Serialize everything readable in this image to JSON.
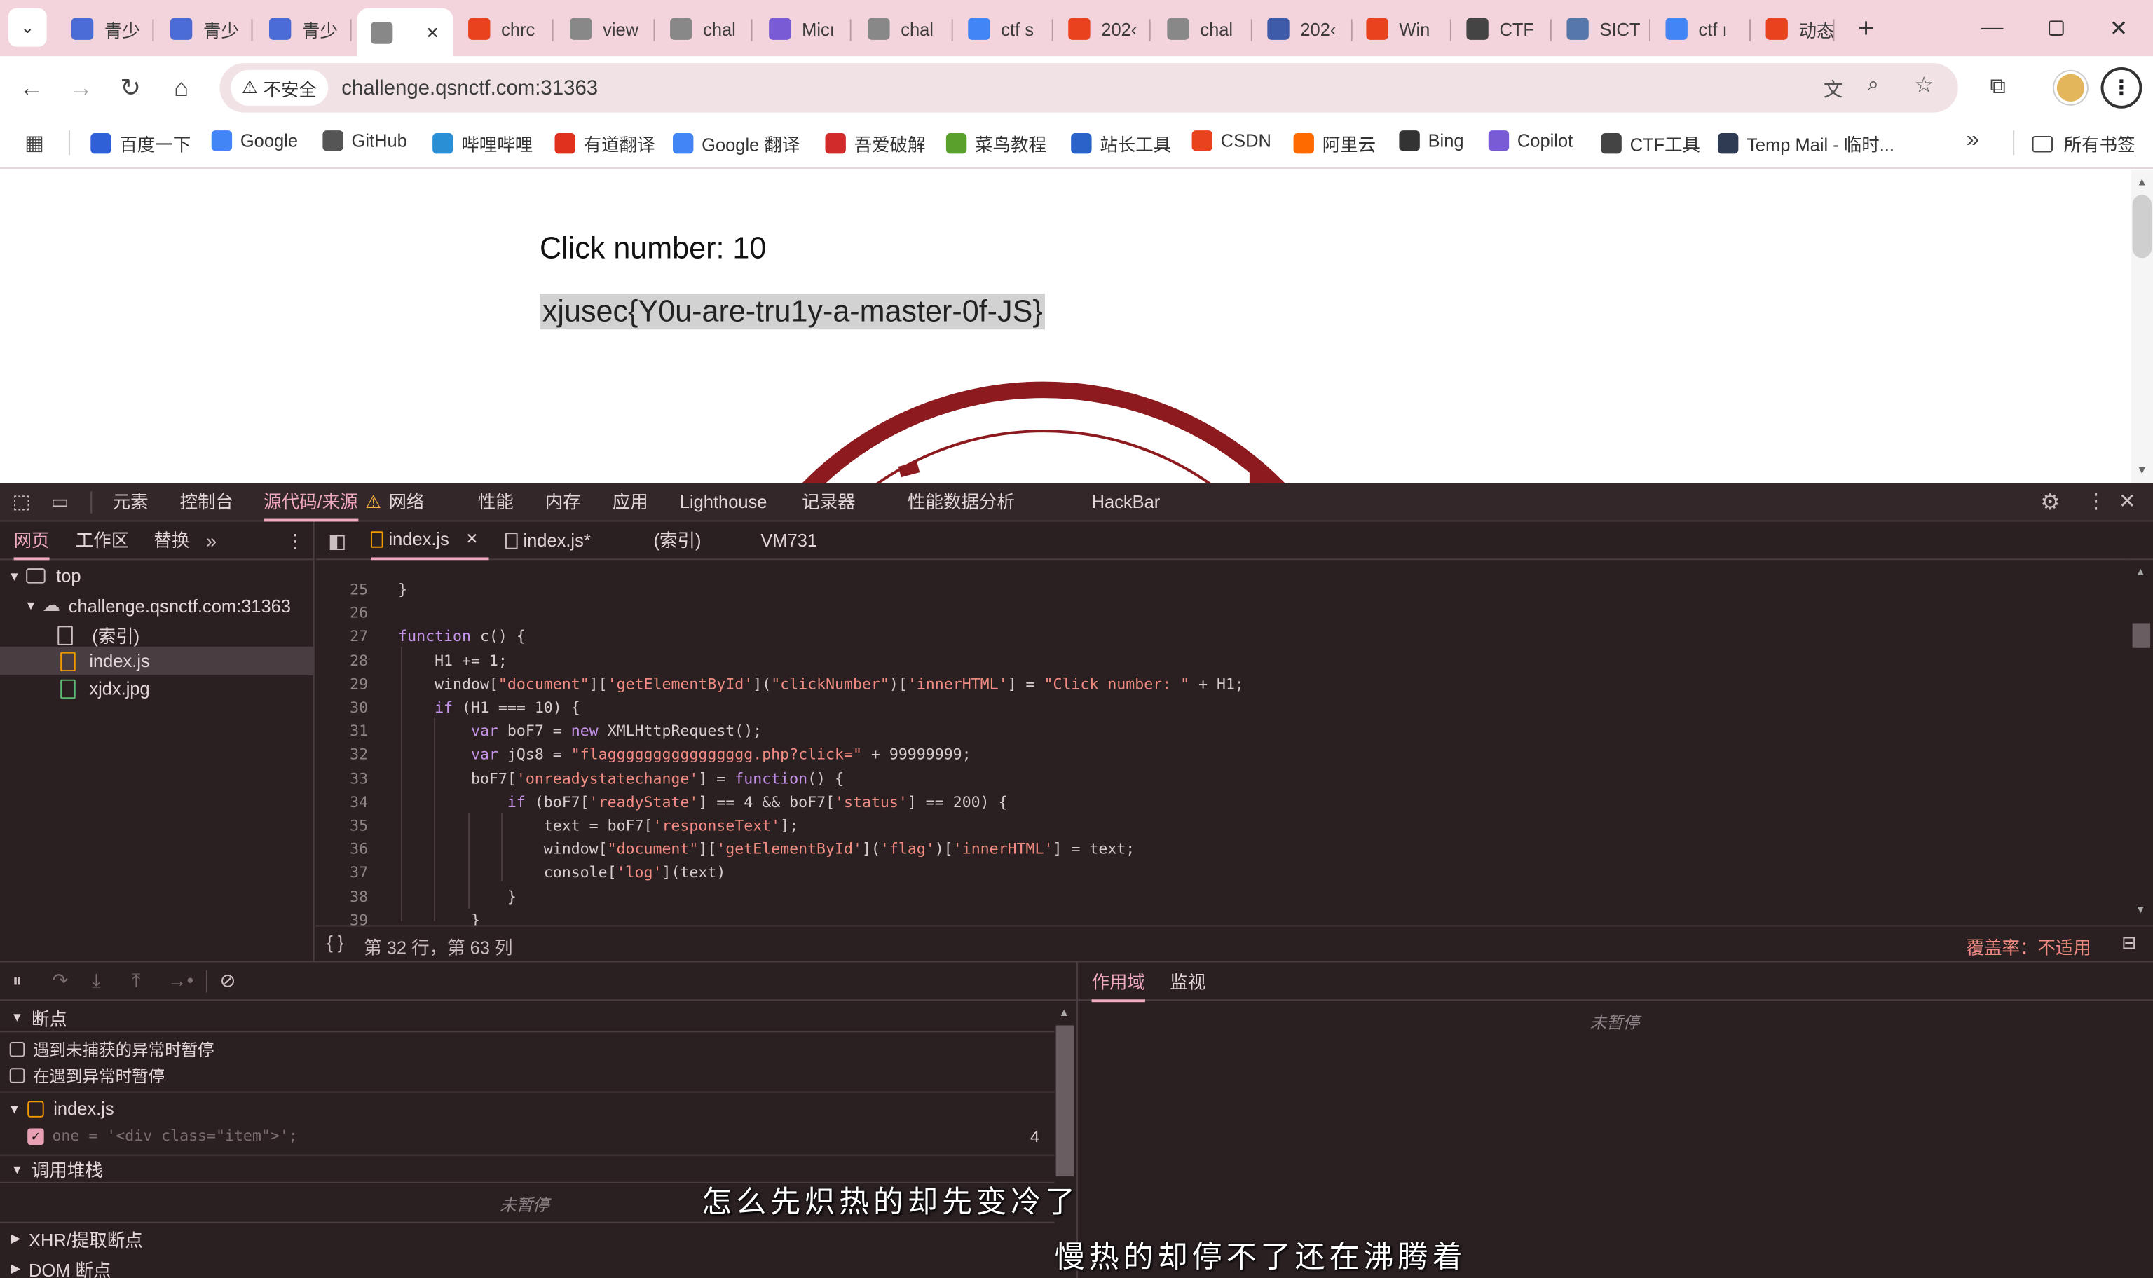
{
  "browser": {
    "tabs": [
      {
        "label": "青少",
        "icon": "bird-icon",
        "color": "#4a6cd4"
      },
      {
        "label": "青少",
        "icon": "bird-icon",
        "color": "#4a6cd4"
      },
      {
        "label": "青少",
        "icon": "bird-icon",
        "color": "#4a6cd4"
      },
      {
        "label": "",
        "icon": "globe-icon",
        "color": "#888888",
        "active": true
      },
      {
        "label": "chrc",
        "icon": "csdn-icon",
        "color": "#e8431f"
      },
      {
        "label": "view",
        "icon": "globe-icon",
        "color": "#888888"
      },
      {
        "label": "chal",
        "icon": "globe-icon",
        "color": "#888888"
      },
      {
        "label": "Micı",
        "icon": "copilot-icon",
        "color": "#7a5bd6"
      },
      {
        "label": "chal",
        "icon": "globe-icon",
        "color": "#888888"
      },
      {
        "label": "ctf s",
        "icon": "google-icon",
        "color": "#4285f4"
      },
      {
        "label": "202‹",
        "icon": "csdn-icon",
        "color": "#e8431f"
      },
      {
        "label": "chal",
        "icon": "globe-icon",
        "color": "#888888"
      },
      {
        "label": "202‹",
        "icon": "image-icon",
        "color": "#3d5ba9"
      },
      {
        "label": "Win",
        "icon": "csdn-icon",
        "color": "#e8431f"
      },
      {
        "label": "CTF",
        "icon": "ctf-icon",
        "color": "#444444"
      },
      {
        "label": "SICT",
        "icon": "sict-icon",
        "color": "#5577aa"
      },
      {
        "label": "ctf ı",
        "icon": "google-icon",
        "color": "#4285f4"
      },
      {
        "label": "动态",
        "icon": "csdn-icon",
        "color": "#e8431f"
      }
    ],
    "new_tab": "+",
    "url": "challenge.qsnctf.com:31363",
    "security_label": "不安全",
    "bookmarks": [
      {
        "label": "百度一下",
        "icon": "baidu-icon",
        "color": "#3060d8"
      },
      {
        "label": "Google",
        "icon": "google-icon",
        "color": "#4285f4"
      },
      {
        "label": "GitHub",
        "icon": "github-icon",
        "color": "#555555"
      },
      {
        "label": "哔哩哔哩",
        "icon": "bilibili-icon",
        "color": "#2b8fd6"
      },
      {
        "label": "有道翻译",
        "icon": "youdao-icon",
        "color": "#e0301e"
      },
      {
        "label": "Google 翻译",
        "icon": "translate-icon",
        "color": "#4285f4"
      },
      {
        "label": "吾爱破解",
        "icon": "52pojie-icon",
        "color": "#d22b2b"
      },
      {
        "label": "菜鸟教程",
        "icon": "runoob-icon",
        "color": "#5aa02c"
      },
      {
        "label": "站长工具",
        "icon": "chinaz-icon",
        "color": "#2a62c9"
      },
      {
        "label": "CSDN",
        "icon": "csdn-icon",
        "color": "#e8431f"
      },
      {
        "label": "阿里云",
        "icon": "aliyun-icon",
        "color": "#ff6a00"
      },
      {
        "label": "Bing",
        "icon": "search-icon",
        "color": "#333333"
      },
      {
        "label": "Copilot",
        "icon": "copilot-icon",
        "color": "#7a5bd6"
      },
      {
        "label": "CTF工具",
        "icon": "ctf-icon",
        "color": "#444444"
      },
      {
        "label": "Temp Mail - 临时...",
        "icon": "tempmail-icon",
        "color": "#2f3b52"
      }
    ],
    "all_bookmarks": "所有书签",
    "more_bookmarks": "»"
  },
  "page": {
    "click_text": "Click number: 10",
    "flag": "xjusec{Y0u-are-tru1y-a-master-0f-JS}"
  },
  "devtools": {
    "main_tabs": [
      "元素",
      "控制台",
      "源代码/来源",
      "网络",
      "性能",
      "内存",
      "应用",
      "Lighthouse",
      "记录器",
      "性能数据分析",
      "HackBar"
    ],
    "active_main_tab": "源代码/来源",
    "nav_tabs": [
      "网页",
      "工作区",
      "替换"
    ],
    "file_tree": {
      "top": "top",
      "host": "challenge.qsnctf.com:31363",
      "files": [
        "(索引)",
        "index.js",
        "xjdx.jpg"
      ]
    },
    "editor_tabs": [
      "index.js",
      "index.js*",
      "(索引)",
      "VM731"
    ],
    "code_lines": [
      {
        "n": "25",
        "text": "}"
      },
      {
        "n": "26",
        "text": ""
      },
      {
        "n": "27",
        "text": "function c() {"
      },
      {
        "n": "28",
        "text": "    H1 += 1;"
      },
      {
        "n": "29",
        "text": "    window[\"document\"]['getElementById'](\"clickNumber\")['innerHTML'] = \"Click number: \" + H1;"
      },
      {
        "n": "30",
        "text": "    if (H1 === 10) {"
      },
      {
        "n": "31",
        "text": "        var boF7 = new XMLHttpRequest();"
      },
      {
        "n": "32",
        "text": "        var jQs8 = \"flagggggggggggggggg.php?click=\" + 99999999;"
      },
      {
        "n": "33",
        "text": "        boF7['onreadystatechange'] = function() {"
      },
      {
        "n": "34",
        "text": "            if (boF7['readyState'] == 4 && boF7['status'] == 200) {"
      },
      {
        "n": "35",
        "text": "                text = boF7['responseText'];"
      },
      {
        "n": "36",
        "text": "                window[\"document\"]['getElementById']('flag')['innerHTML'] = text;"
      },
      {
        "n": "37",
        "text": "                console['log'](text)"
      },
      {
        "n": "38",
        "text": "            }"
      },
      {
        "n": "39",
        "text": "        }"
      }
    ],
    "status_position": "第 32 行，第 63 列",
    "coverage": "覆盖率：不适用",
    "breakpoints_header": "断点",
    "pause_uncaught": "遇到未捕获的异常时暂停",
    "pause_caught": "在遇到异常时暂停",
    "bp_file": "index.js",
    "bp_line_code": "one = '<div class=\"item\">';",
    "bp_line_num": "4",
    "callstack_header": "调用堆栈",
    "not_paused": "未暂停",
    "xhr_breakpoints": "XHR/提取断点",
    "dom_breakpoints": "DOM 断点",
    "right_tabs": [
      "作用域",
      "监视"
    ],
    "scope_not_paused": "未暂停"
  },
  "subtitles": {
    "line1": "怎么先炽热的却先变冷了",
    "line2": "慢热的却停不了还在沸腾着"
  }
}
